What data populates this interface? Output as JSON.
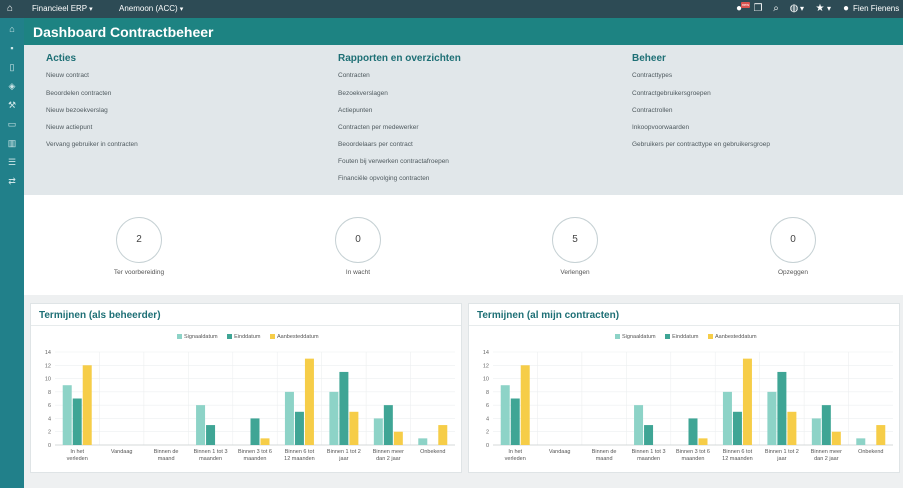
{
  "topbar": {
    "app_menu": "Financieel ERP",
    "env_menu": "Anemoon (ACC)",
    "badge": "new",
    "user": "Fien Fienens"
  },
  "page": {
    "title": "Dashboard Contractbeheer"
  },
  "links": {
    "acties": {
      "heading": "Acties",
      "items": [
        "Nieuw contract",
        "Beoordelen contracten",
        "Nieuw bezoekverslag",
        "Nieuw actiepunt",
        "Vervang gebruiker in contracten"
      ]
    },
    "rapporten": {
      "heading": "Rapporten en overzichten",
      "items": [
        "Contracten",
        "Bezoekverslagen",
        "Actiepunten",
        "Contracten per medewerker",
        "Beoordelaars per contract",
        "Fouten bij verwerken contractafroepen",
        "Financiële opvolging contracten"
      ]
    },
    "beheer": {
      "heading": "Beheer",
      "items": [
        "Contracttypes",
        "Contractgebruikersgroepen",
        "Contractrollen",
        "Inkoopvoorwaarden",
        "Gebruikers per contracttype en gebruikersgroep"
      ]
    }
  },
  "kpis": [
    {
      "value": "2",
      "label": "Ter voorbereiding"
    },
    {
      "value": "0",
      "label": "In wacht"
    },
    {
      "value": "5",
      "label": "Verlengen"
    },
    {
      "value": "0",
      "label": "Opzeggen"
    }
  ],
  "colors": {
    "signaaldatum": "#8dd3c7",
    "einddatum": "#3fa595",
    "aanbesteddatum": "#f6cd48"
  },
  "chart_data": [
    {
      "type": "bar",
      "title": "Termijnen (als beheerder)",
      "categories": [
        "In het verleden",
        "Vandaag",
        "Binnen de maand",
        "Binnen 1 tot 3 maanden",
        "Binnen 3 tot 6 maanden",
        "Binnen 6 tot 12 maanden",
        "Binnen 1 tot 2 jaar",
        "Binnen meer dan 2 jaar",
        "Onbekend"
      ],
      "series": [
        {
          "name": "Signaaldatum",
          "values": [
            9,
            0,
            0,
            6,
            0,
            8,
            8,
            4,
            1
          ]
        },
        {
          "name": "Einddatum",
          "values": [
            7,
            0,
            0,
            3,
            4,
            5,
            11,
            6,
            0
          ]
        },
        {
          "name": "Aanbesteddatum",
          "values": [
            12,
            0,
            0,
            0,
            1,
            13,
            5,
            2,
            3
          ]
        }
      ],
      "yticks": [
        "0",
        "2",
        "4",
        "6",
        "8",
        "10",
        "12",
        "14"
      ],
      "ylim": [
        0,
        14
      ]
    },
    {
      "type": "bar",
      "title": "Termijnen (al mijn contracten)",
      "categories": [
        "In het verleden",
        "Vandaag",
        "Binnen de maand",
        "Binnen 1 tot 3 maanden",
        "Binnen 3 tot 6 maanden",
        "Binnen 6 tot 12 maanden",
        "Binnen 1 tot 2 jaar",
        "Binnen meer dan 2 jaar",
        "Onbekend"
      ],
      "series": [
        {
          "name": "Signaaldatum",
          "values": [
            9,
            0,
            0,
            6,
            0,
            8,
            8,
            4,
            1
          ]
        },
        {
          "name": "Einddatum",
          "values": [
            7,
            0,
            0,
            3,
            4,
            5,
            11,
            6,
            0
          ]
        },
        {
          "name": "Aanbesteddatum",
          "values": [
            12,
            0,
            0,
            0,
            1,
            13,
            5,
            2,
            3
          ]
        }
      ],
      "yticks": [
        "0",
        "2",
        "4",
        "6",
        "8",
        "10",
        "12",
        "14"
      ],
      "ylim": [
        0,
        14
      ]
    }
  ]
}
